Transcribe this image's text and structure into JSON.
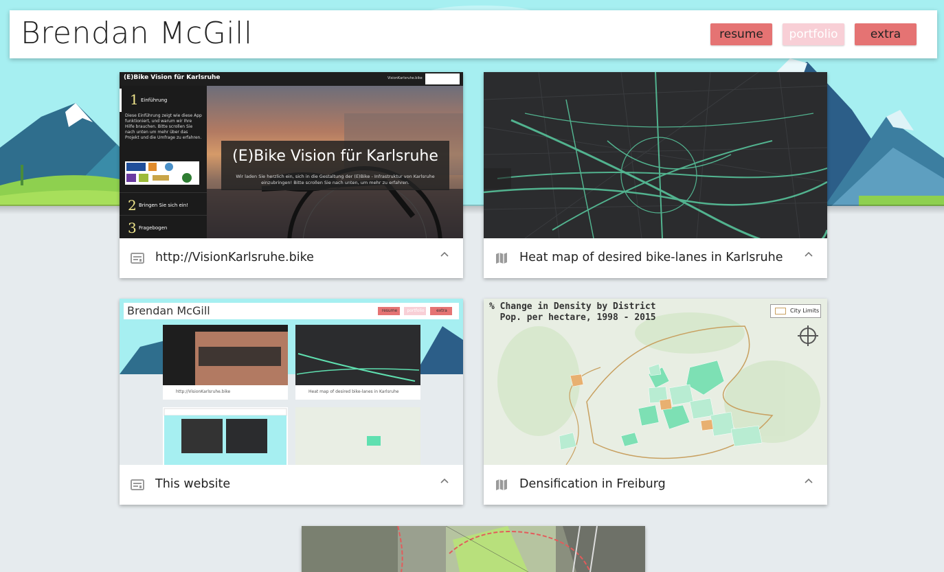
{
  "header": {
    "title": "Brendan McGill",
    "nav": {
      "resume": "resume",
      "portfolio": "portfolio",
      "extra": "extra"
    }
  },
  "cards": [
    {
      "label": "http://VisionKarlsruhe.bike",
      "icon": "web-page-icon"
    },
    {
      "label": "Heat map of desired bike-lanes in Karlsruhe",
      "icon": "map-icon"
    },
    {
      "label": "This website",
      "icon": "web-page-icon"
    },
    {
      "label": "Densification in Freiburg",
      "icon": "map-icon"
    }
  ],
  "thumb_ebike": {
    "top_title": "(E)Bike Vision für Karlsruhe",
    "top_url": "VisionKarlsruhe.bike",
    "banner_title": "(E)Bike Vision für Karlsruhe",
    "banner_sub": "Wir laden Sie herzlich ein, sich in die Gestaltung der (E)Bike - Infrastruktur von Karlsruhe einzubringen! Bitte scrollen Sie nach unten, um mehr zu erfahren.",
    "desc": "Diese Einführung zeigt wie diese App funktioniert, und warum wir Ihre Hilfe brauchen. Bitte scrollen Sie nach unten um mehr über das Projekt und die Umfrage zu erfahren.",
    "steps": [
      {
        "num": "1",
        "text": "Einführung"
      },
      {
        "num": "2",
        "text": "Bringen Sie sich ein!"
      },
      {
        "num": "3",
        "text": "Fragebogen"
      }
    ]
  },
  "thumb_freiburg": {
    "title": "% Change in Density by District\n  Pop. per hectare, 1998 - 2015",
    "legend": "City Limits"
  },
  "thumb_website": {
    "mini_title": "Brendan McGill",
    "mini_nav": [
      "resume",
      "portfolio",
      "extra"
    ],
    "mini_cards": [
      "http://VisionKarlsruhe.bike",
      "Heat map of desired bike-lanes in Karlsruhe"
    ]
  },
  "colors": {
    "nav_active": "#e57373",
    "nav_current": "#f8cfd6",
    "hero_sky": "#a4eef0"
  }
}
